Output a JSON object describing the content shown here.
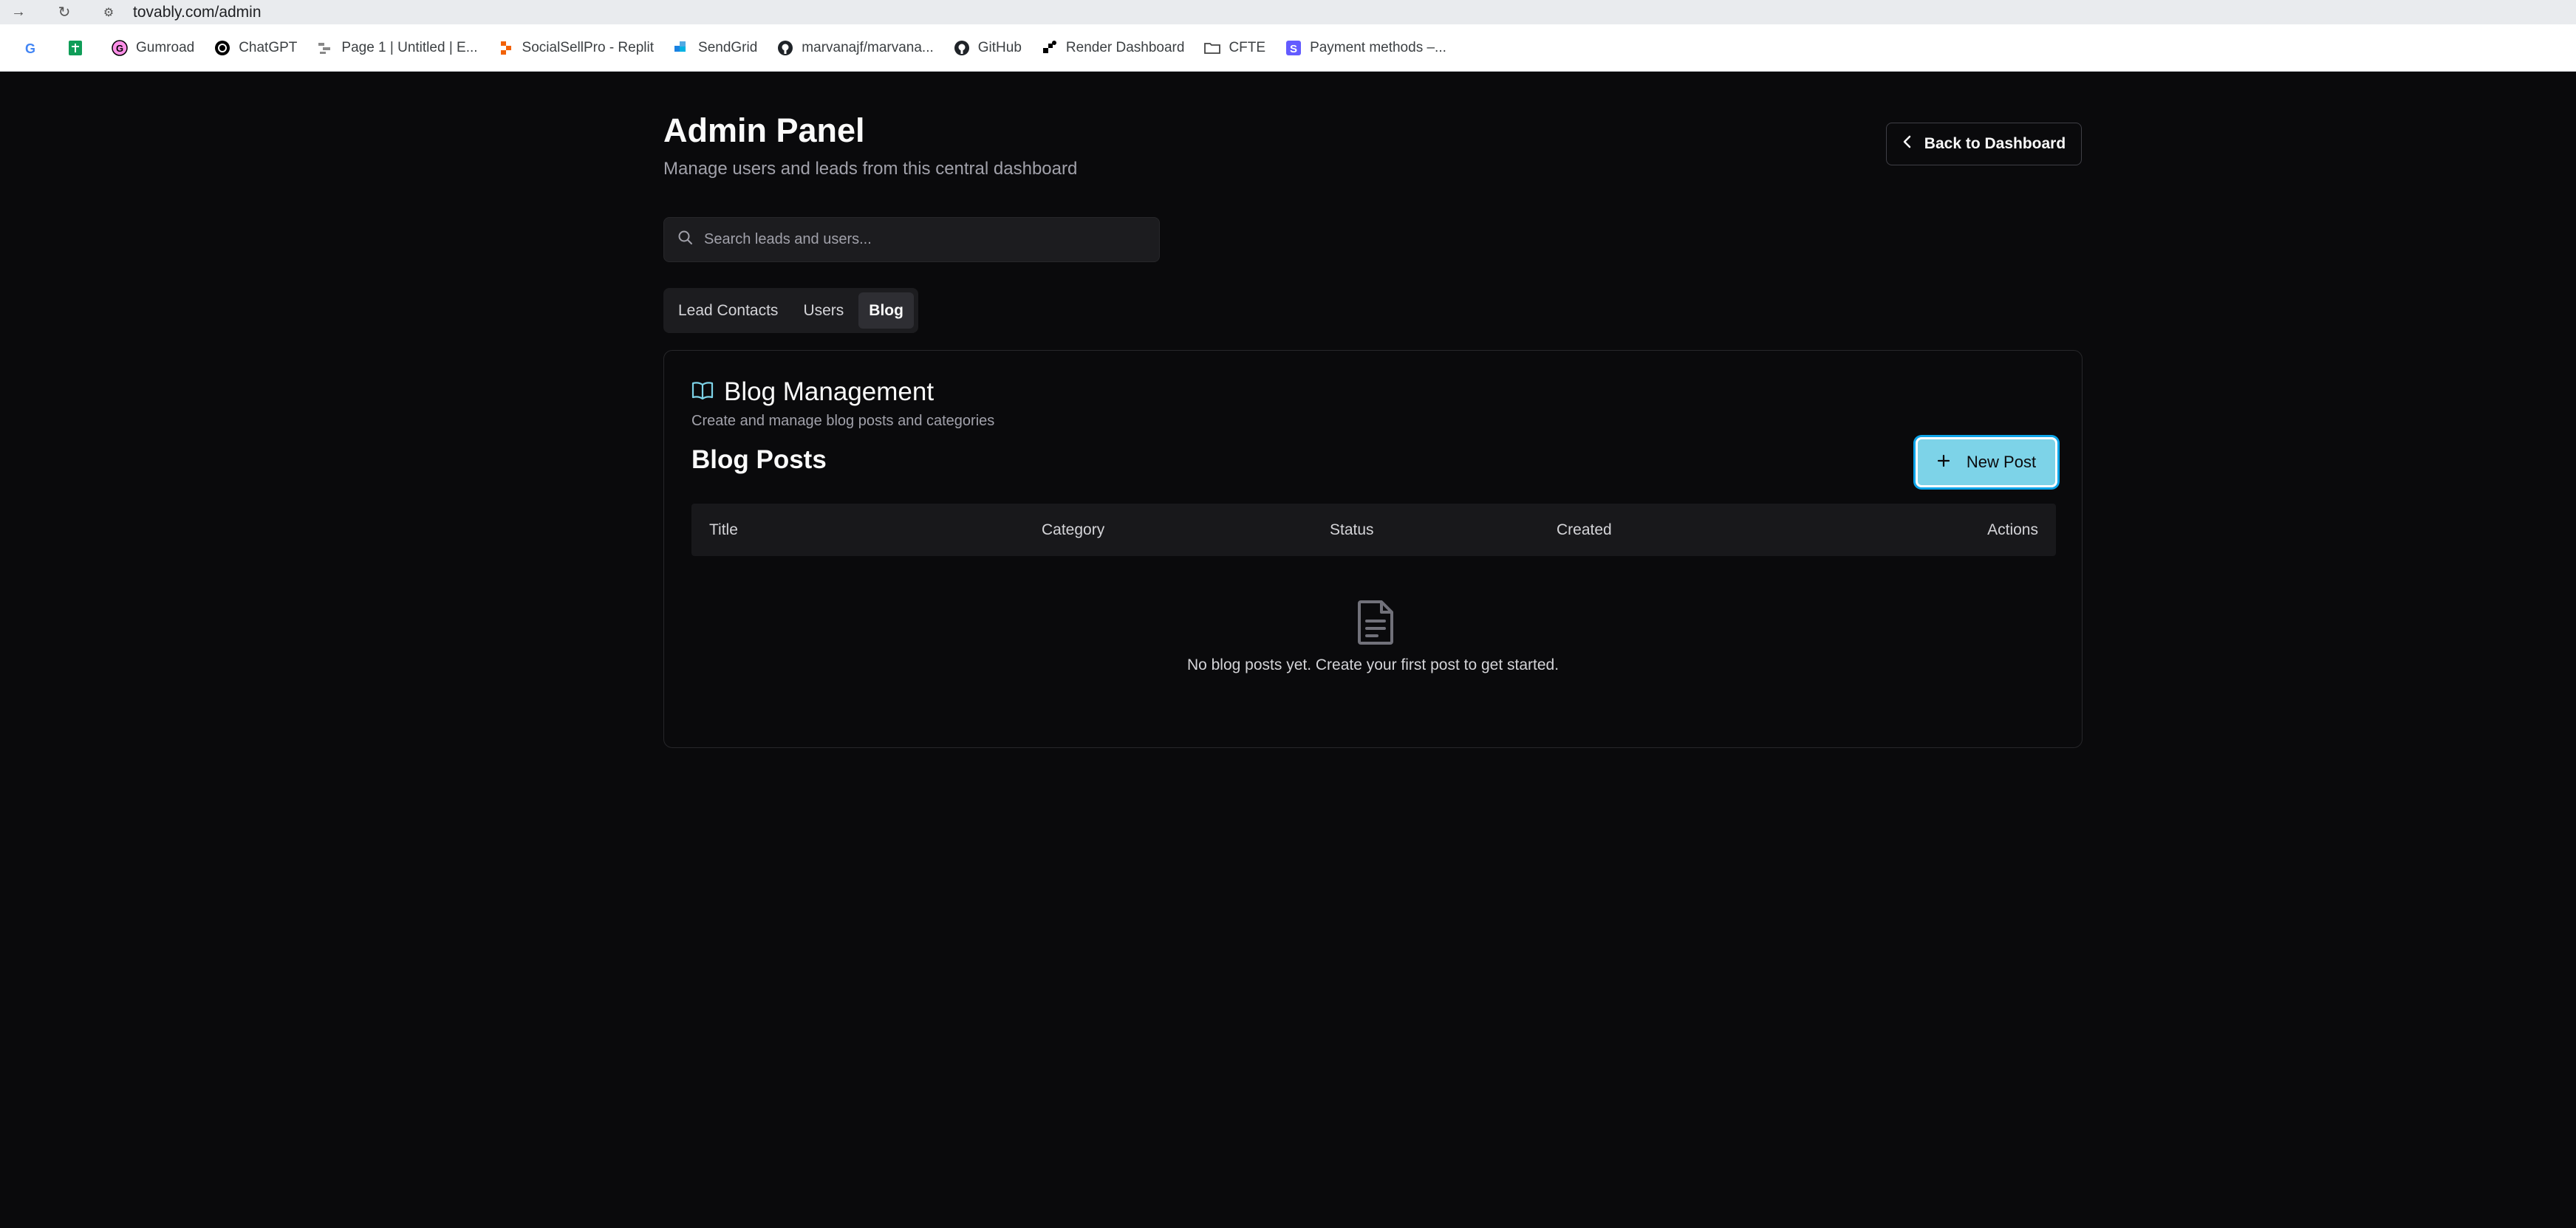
{
  "browser": {
    "url": "tovably.com/admin",
    "bookmarks": [
      {
        "label": "",
        "icon": "google-icon"
      },
      {
        "label": "",
        "icon": "sheets-icon"
      },
      {
        "label": "Gumroad",
        "icon": "gumroad-icon"
      },
      {
        "label": "ChatGPT",
        "icon": "chatgpt-icon"
      },
      {
        "label": "Page 1 | Untitled | E...",
        "icon": "page-icon"
      },
      {
        "label": "SocialSellPro - Replit",
        "icon": "replit-icon"
      },
      {
        "label": "SendGrid",
        "icon": "sendgrid-icon"
      },
      {
        "label": "marvanajf/marvana...",
        "icon": "github-icon"
      },
      {
        "label": "GitHub",
        "icon": "github-icon"
      },
      {
        "label": "Render Dashboard",
        "icon": "render-icon"
      },
      {
        "label": "CFTE",
        "icon": "folder-icon"
      },
      {
        "label": "Payment methods –...",
        "icon": "stripe-icon"
      }
    ]
  },
  "header": {
    "title": "Admin Panel",
    "subtitle": "Manage users and leads from this central dashboard",
    "back_label": "Back to Dashboard"
  },
  "search": {
    "placeholder": "Search leads and users..."
  },
  "tabs": [
    {
      "label": "Lead Contacts",
      "active": false
    },
    {
      "label": "Users",
      "active": false
    },
    {
      "label": "Blog",
      "active": true
    }
  ],
  "blog": {
    "title": "Blog Management",
    "description": "Create and manage blog posts and categories",
    "posts_title": "Blog Posts",
    "new_post_label": "New Post",
    "columns": [
      "Title",
      "Category",
      "Status",
      "Created",
      "Actions"
    ],
    "empty_text": "No blog posts yet. Create your first post to get started."
  },
  "colors": {
    "accent": "#7dd3e8",
    "background": "#0a0a0c"
  }
}
